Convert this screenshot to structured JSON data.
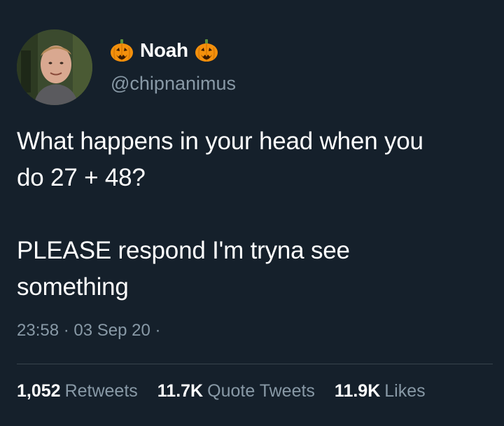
{
  "user": {
    "display_name": "Noah",
    "handle": "@chipnanimus",
    "emoji_left": "jack-o-lantern",
    "emoji_right": "jack-o-lantern"
  },
  "tweet": {
    "line1": "What happens in your head when you",
    "line2": "do 27 + 48?",
    "line3": "PLEASE respond I'm tryna see",
    "line4": "something",
    "time": "23:58",
    "date": "03 Sep 20",
    "separator": "·"
  },
  "stats": {
    "retweets_count": "1,052",
    "retweets_label": "Retweets",
    "quotes_count": "11.7K",
    "quotes_label": "Quote Tweets",
    "likes_count": "11.9K",
    "likes_label": "Likes"
  },
  "colors": {
    "background": "#15202b",
    "text": "#ffffff",
    "secondary": "#8899a6",
    "divider": "#38444d",
    "pumpkin": "#f4900c"
  }
}
